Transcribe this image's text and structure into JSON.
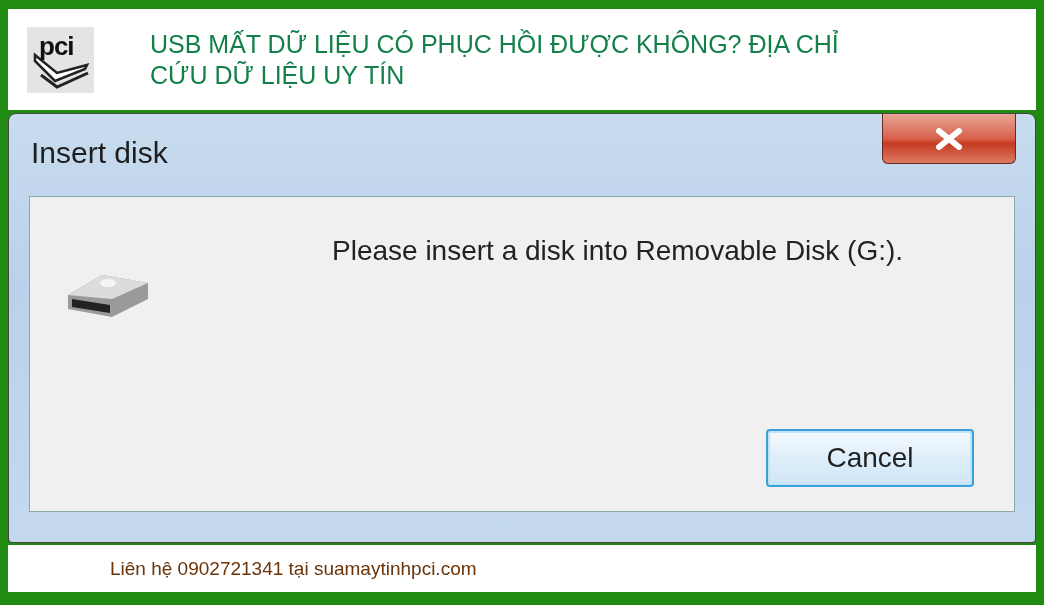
{
  "header": {
    "logo_text": "pci",
    "title": "USB MẤT DỮ LIỆU CÓ PHỤC HỒI ĐƯỢC KHÔNG? ĐỊA CHỈ CỨU DỮ LIỆU UY TÍN"
  },
  "dialog": {
    "title": "Insert disk",
    "message": "Please insert a disk into Removable Disk (G:).",
    "buttons": [
      "Cancel"
    ]
  },
  "footer": {
    "text": "Liên hệ 0902721341 tại suamaytinhpci.com"
  }
}
